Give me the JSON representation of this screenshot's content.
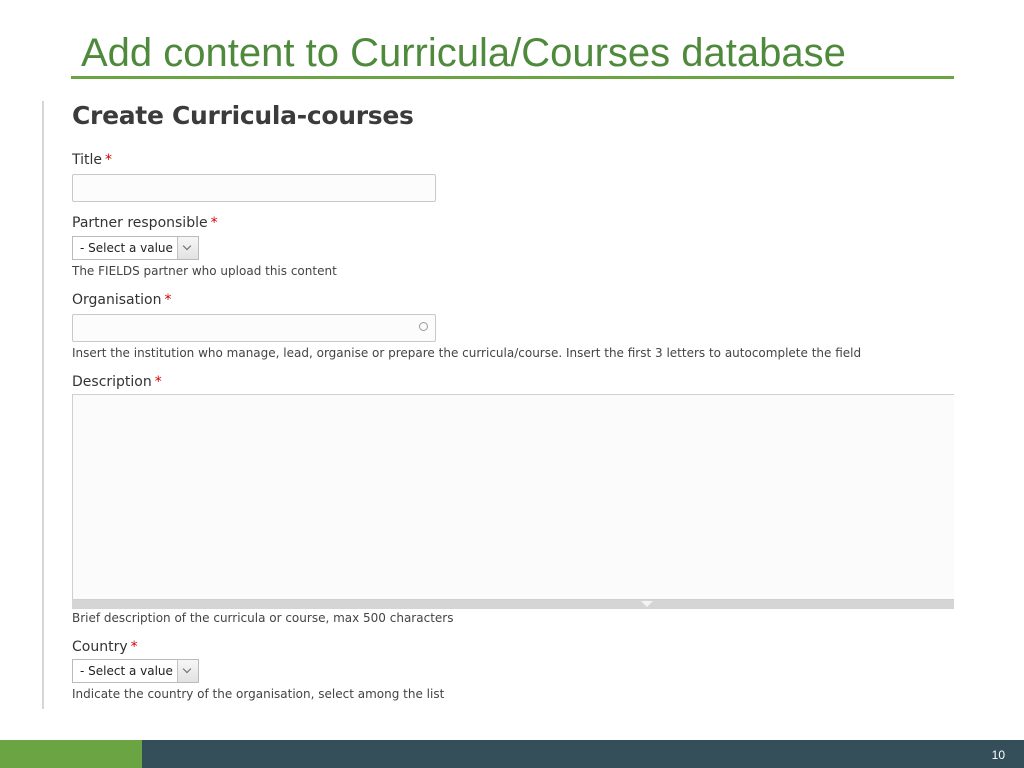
{
  "slide": {
    "title": "Add content to Curricula/Courses database",
    "page_number": "10"
  },
  "form": {
    "heading": "Create Curricula-courses",
    "required_marker": "*",
    "title_field": {
      "label": "Title",
      "value": ""
    },
    "partner_field": {
      "label": "Partner responsible",
      "selected": "- Select a value -",
      "help": "The FIELDS partner who upload this content"
    },
    "organisation_field": {
      "label": "Organisation",
      "value": "",
      "help": "Insert the institution who manage, lead, organise or prepare the curricula/course. Insert the first 3 letters to autocomplete the field"
    },
    "description_field": {
      "label": "Description",
      "value": "",
      "help": "Brief description of the curricula or course, max 500 characters"
    },
    "country_field": {
      "label": "Country",
      "selected": "- Select a value -",
      "help": "Indicate the country of the organisation, select among the list"
    }
  },
  "colors": {
    "title_green": "#4f8a3c",
    "rule_green": "#6aa443",
    "footer_dark": "#344f5a",
    "required_red": "#d40000"
  },
  "icons": {
    "autocomplete": "throbber-circle-icon",
    "select_arrow": "chevron-down-icon",
    "resize_handle": "triangle-down-icon"
  }
}
